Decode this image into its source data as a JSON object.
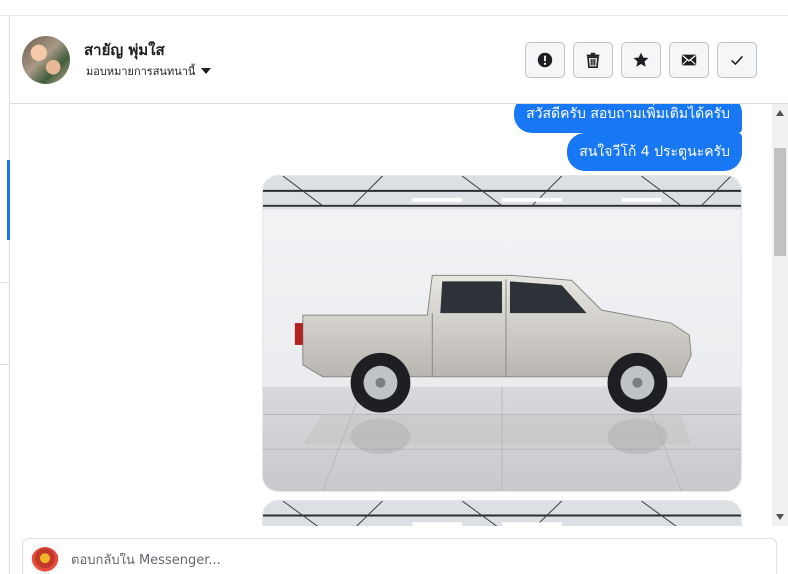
{
  "header": {
    "contact_name": "สายัญ พุ่มใส",
    "assign_label": "มอบหมายการสนทนานี้",
    "actions": [
      {
        "name": "report-button",
        "icon": "exclamation-circle-icon"
      },
      {
        "name": "delete-button",
        "icon": "trash-icon"
      },
      {
        "name": "star-button",
        "icon": "star-icon"
      },
      {
        "name": "mark-unread-button",
        "icon": "envelope-icon"
      },
      {
        "name": "mark-done-button",
        "icon": "check-icon"
      }
    ]
  },
  "messages": [
    {
      "type": "text",
      "text": "สวัสดีครับ สอบถามเพิ่มเติมได้ครับ"
    },
    {
      "type": "text",
      "text": "สนใจวีโก้ 4 ประตูนะครับ"
    },
    {
      "type": "image",
      "subject": "silver pickup truck"
    },
    {
      "type": "image",
      "subject": "silver pickup truck"
    }
  ],
  "composer": {
    "placeholder": "ตอบกลับใน Messenger..."
  },
  "colors": {
    "accent": "#1877f2",
    "bubble_text": "#ffffff",
    "border": "#dddfe2"
  }
}
